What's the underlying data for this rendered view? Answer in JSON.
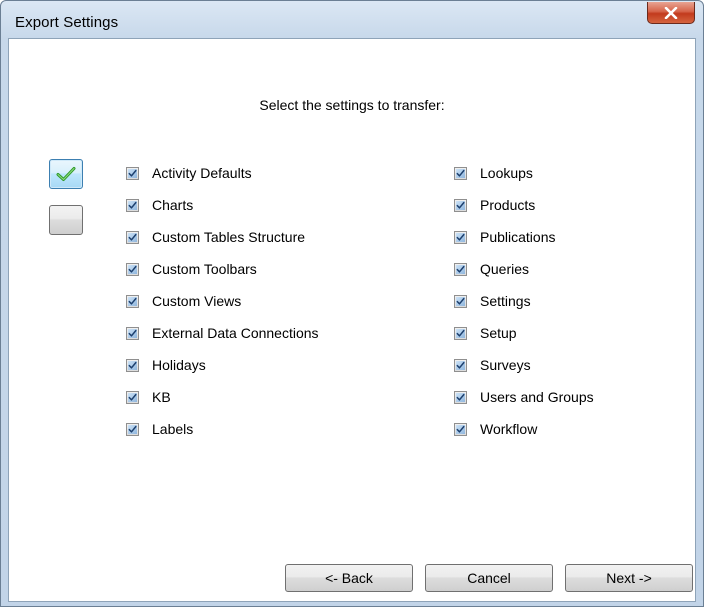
{
  "window": {
    "title": "Export Settings"
  },
  "dialog": {
    "heading": "Select the settings to transfer:",
    "left_items": [
      {
        "label": "Activity Defaults",
        "checked": true
      },
      {
        "label": "Charts",
        "checked": true
      },
      {
        "label": "Custom Tables Structure",
        "checked": true
      },
      {
        "label": "Custom Toolbars",
        "checked": true
      },
      {
        "label": "Custom Views",
        "checked": true
      },
      {
        "label": "External Data Connections",
        "checked": true
      },
      {
        "label": "Holidays",
        "checked": true
      },
      {
        "label": "KB",
        "checked": true
      },
      {
        "label": "Labels",
        "checked": true
      }
    ],
    "right_items": [
      {
        "label": "Lookups",
        "checked": true
      },
      {
        "label": "Products",
        "checked": true
      },
      {
        "label": "Publications",
        "checked": true
      },
      {
        "label": "Queries",
        "checked": true
      },
      {
        "label": "Settings",
        "checked": true
      },
      {
        "label": "Setup",
        "checked": true
      },
      {
        "label": "Surveys",
        "checked": true
      },
      {
        "label": "Users and Groups",
        "checked": true
      },
      {
        "label": "Workflow",
        "checked": true
      }
    ]
  },
  "buttons": {
    "back": "<- Back",
    "cancel": "Cancel",
    "next": "Next ->"
  },
  "icons": {
    "select_all": "checkmark-icon",
    "clear_all": "blank-icon",
    "close": "close-icon"
  },
  "colors": {
    "check_green": "#3aa832",
    "close_red": "#c8452a",
    "frame_blue": "#c7d8ea"
  }
}
